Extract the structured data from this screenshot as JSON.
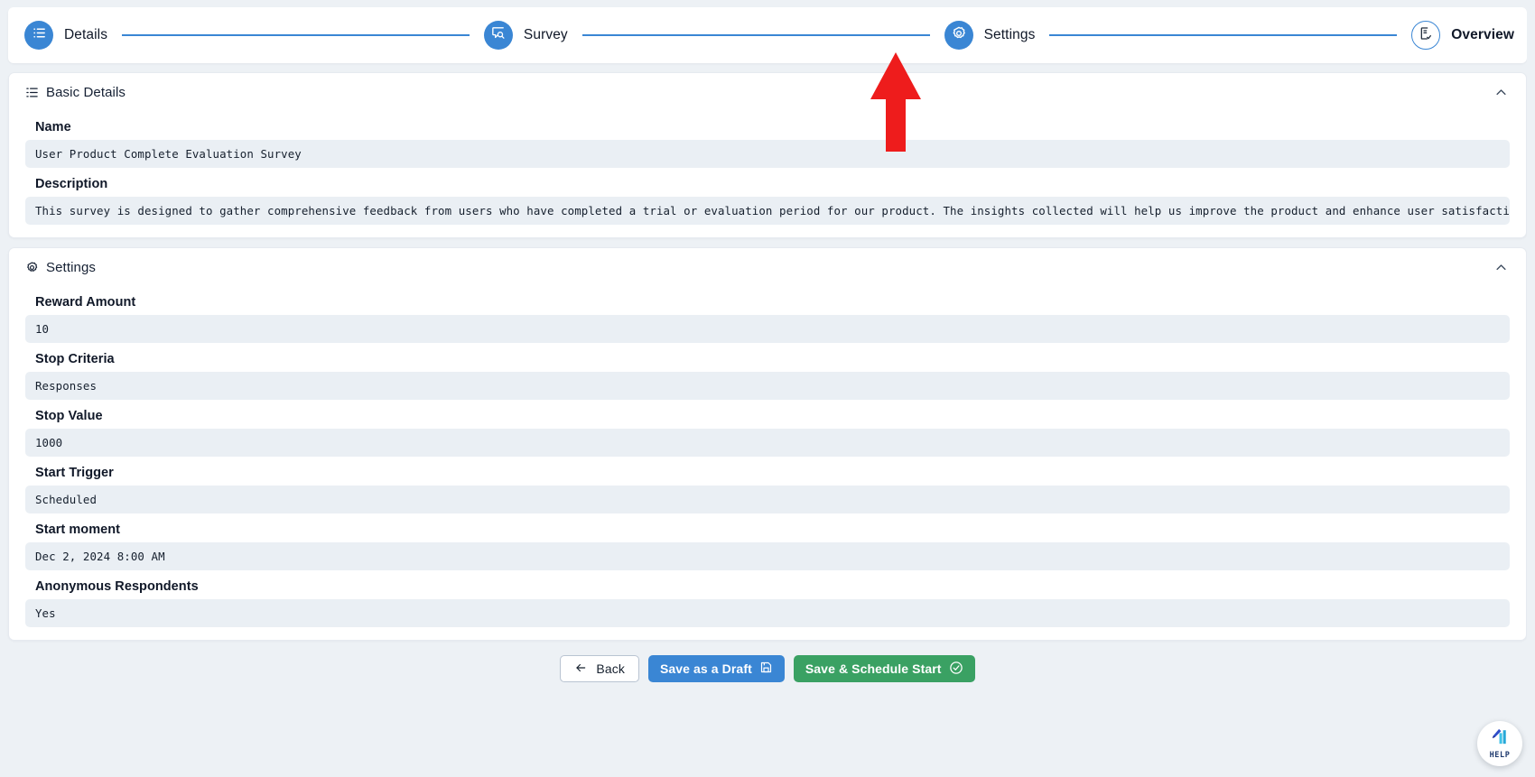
{
  "stepper": {
    "steps": [
      {
        "label": "Details",
        "icon": "list-icon",
        "state": "done"
      },
      {
        "label": "Survey",
        "icon": "survey-search-icon",
        "state": "done"
      },
      {
        "label": "Settings",
        "icon": "gear-icon",
        "state": "done"
      },
      {
        "label": "Overview",
        "icon": "document-check-icon",
        "state": "todo"
      }
    ],
    "active_index": 2,
    "line_color": "#3a86d4",
    "circle_color": "#3a86d4"
  },
  "annotation": {
    "arrow_color": "#ee1c1c",
    "points_at": "Settings"
  },
  "basic_details": {
    "title": "Basic Details",
    "icon": "list-details-icon",
    "collapse_icon": "chevron-up-icon",
    "fields": [
      {
        "label": "Name",
        "value": "User Product Complete Evaluation Survey"
      },
      {
        "label": "Description",
        "value": "This survey is designed to gather comprehensive feedback from users who have completed a trial or evaluation period for our product. The insights collected will help us improve the product and enhance user satisfaction."
      }
    ]
  },
  "settings": {
    "title": "Settings",
    "icon": "gear-icon",
    "collapse_icon": "chevron-up-icon",
    "fields": [
      {
        "label": "Reward Amount",
        "value": "10"
      },
      {
        "label": "Stop Criteria",
        "value": "Responses"
      },
      {
        "label": "Stop Value",
        "value": "1000"
      },
      {
        "label": "Start Trigger",
        "value": "Scheduled"
      },
      {
        "label": "Start moment",
        "value": "Dec 2, 2024 8:00 AM"
      },
      {
        "label": "Anonymous Respondents",
        "value": "Yes"
      }
    ]
  },
  "footer": {
    "back_label": "Back",
    "draft_label": "Save as a Draft",
    "schedule_label": "Save & Schedule Start",
    "draft_color": "#3a86d4",
    "schedule_color": "#3aa163"
  },
  "help_widget": {
    "label": "HELP",
    "icon": "chart-pencil-icon"
  }
}
